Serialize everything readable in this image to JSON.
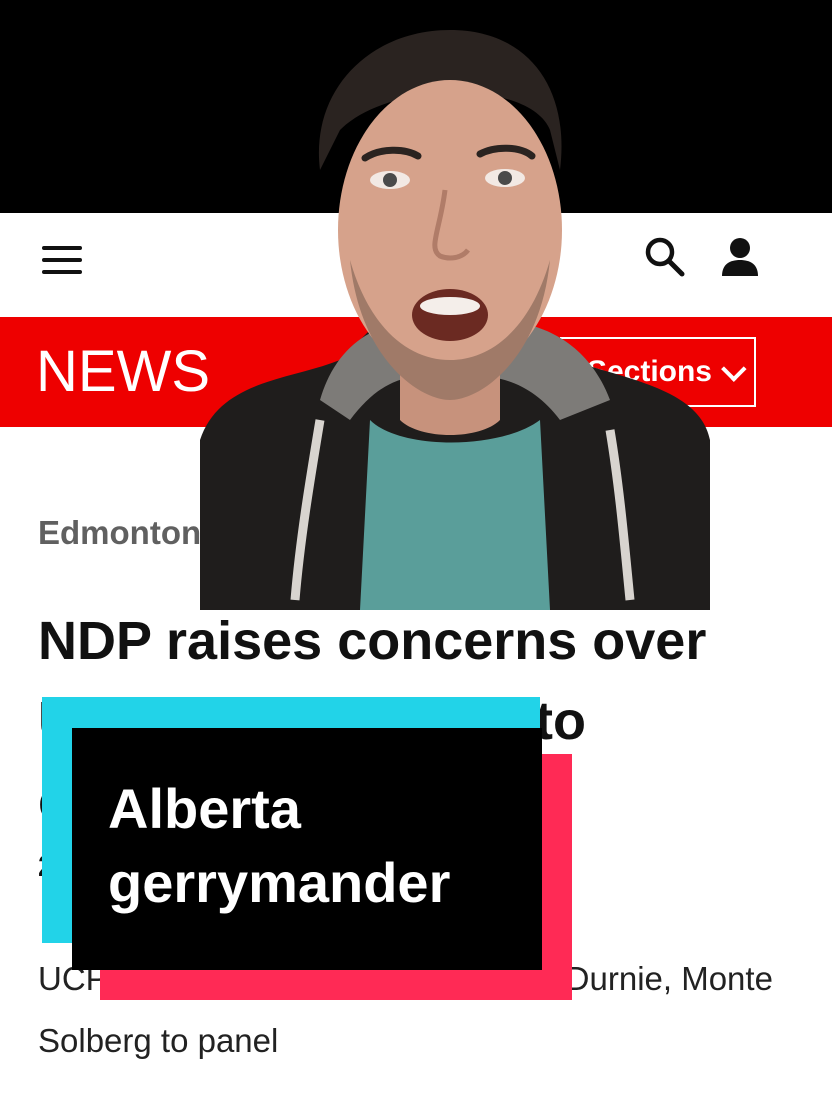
{
  "header": {
    "logo_text": "NEWS",
    "sections_label": "Sections",
    "menu_icon": "hamburger-menu-icon",
    "search_icon": "search-icon",
    "account_icon": "user-icon"
  },
  "article": {
    "kicker": "Edmonton",
    "headline": "NDP raises concerns over UCP appointments to electoral boundaries",
    "byline_fragment": "2",
    "deck": "UCP government to appoint Darwin Durnie, Monte Solberg to panel"
  },
  "caption": {
    "line1": "Alberta",
    "line2": "gerrymander"
  },
  "colors": {
    "brand_red": "#ee0000",
    "caption_cyan": "#22d3e8",
    "caption_pink": "#ff2a55"
  }
}
